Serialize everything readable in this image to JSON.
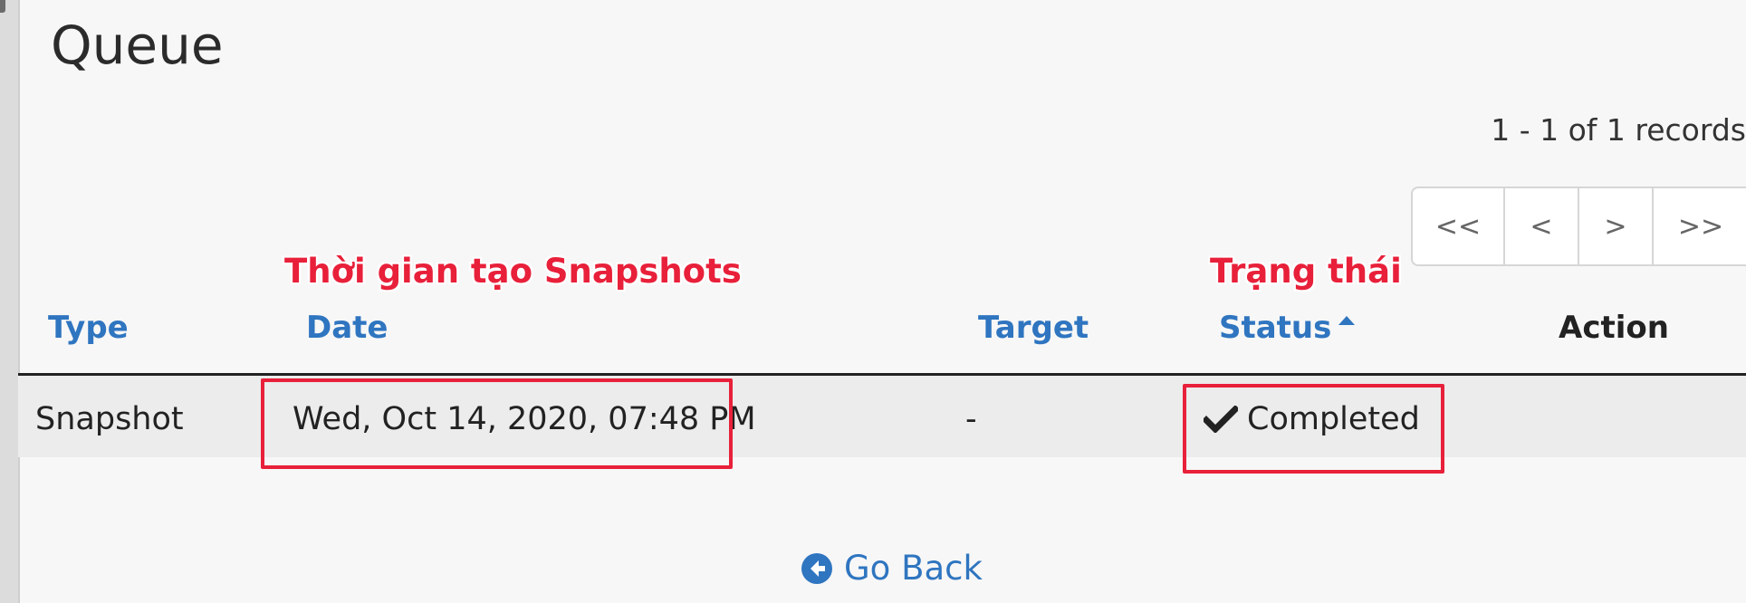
{
  "page": {
    "title": "Queue",
    "records_summary": "1 - 1 of 1 records"
  },
  "pagination": {
    "first": "<<",
    "prev": "<",
    "next": ">",
    "last": ">>"
  },
  "annotations": {
    "date_label": "Thời gian tạo Snapshots",
    "status_label": "Trạng thái",
    "color": "#e8203a"
  },
  "table": {
    "columns": {
      "type": "Type",
      "date": "Date",
      "target": "Target",
      "status": "Status",
      "action": "Action"
    },
    "sort": {
      "column": "status",
      "direction": "ascending"
    },
    "rows": [
      {
        "type": "Snapshot",
        "date": "Wed, Oct 14, 2020, 07:48 PM",
        "target": "-",
        "status": "Completed",
        "status_icon": "check-icon"
      }
    ]
  },
  "footer": {
    "go_back": "Go Back",
    "go_back_icon": "arrow-circle-left-icon"
  },
  "colors": {
    "link": "#2f75c0",
    "annotation": "#e8203a",
    "row_bg": "#ececec"
  }
}
